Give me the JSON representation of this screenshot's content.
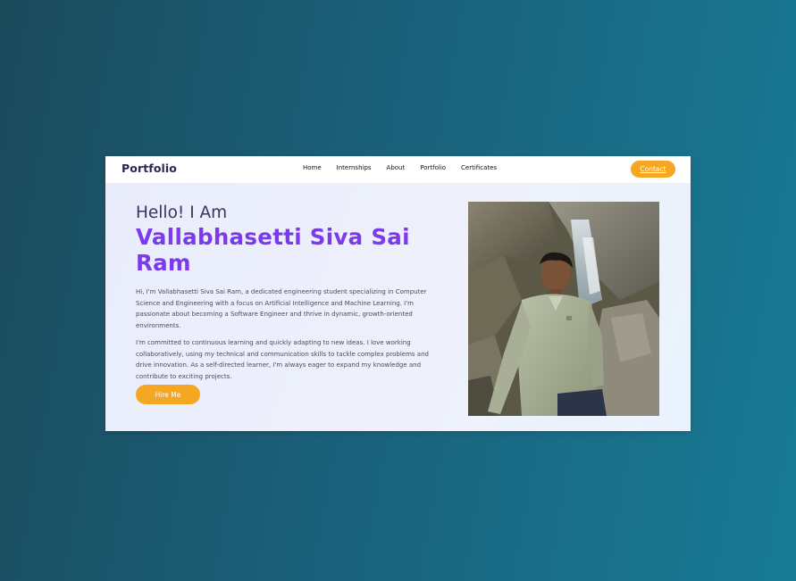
{
  "navbar": {
    "brand": "Portfolio",
    "links": [
      "Home",
      "Internships",
      "About",
      "Portfolio",
      "Certificates"
    ],
    "contact_label": "Contact"
  },
  "hero": {
    "greeting": "Hello! I Am",
    "name": "Vallabhasetti Siva Sai Ram",
    "paragraph_1": "Hi, I'm Vallabhasetti Siva Sai Ram, a dedicated engineering student specializing in Computer Science and Engineering with a focus on Artificial Intelligence and Machine Learning. I'm passionate about becoming a Software Engineer and thrive in dynamic, growth-oriented environments.",
    "paragraph_2": "I'm committed to continuous learning and quickly adapting to new ideas. I love working collaboratively, using my technical and communication skills to tackle complex problems and drive innovation. As a self-directed learner, I'm always eager to expand my knowledge and contribute to exciting projects.",
    "hire_label": "Hire Me"
  },
  "colors": {
    "accent_orange": "#f5a623",
    "name_purple": "#7c3aed",
    "brand_dark": "#2d2456",
    "background_teal": "#1a607a"
  }
}
